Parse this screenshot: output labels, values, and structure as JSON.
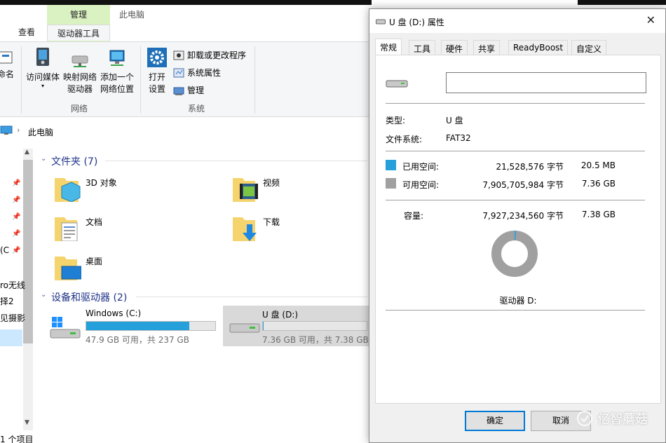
{
  "explorer": {
    "ribbon": {
      "context_group": "管理",
      "window_title": "此电脑",
      "tabs": [
        "查看",
        "驱动器工具"
      ],
      "left_cut_label": "命名",
      "buttons": {
        "media": "访问媒体",
        "map_line1": "映射网络",
        "map_line2": "驱动器",
        "addnet_line1": "添加一个",
        "addnet_line2": "网络位置",
        "open_line1": "打开",
        "open_line2": "设置"
      },
      "small_buttons": [
        "卸载或更改程序",
        "系统属性",
        "管理"
      ],
      "groups": {
        "network": "网络",
        "system": "系统"
      }
    },
    "address": {
      "path": "此电脑"
    },
    "nav": {
      "items": [
        "(C",
        "ro无线",
        "择2",
        "见摄影"
      ]
    },
    "folders_section": {
      "title": "文件夹 (7)",
      "folders": [
        {
          "name": "3D 对象",
          "icon": "3d-objects-folder-icon"
        },
        {
          "name": "视频",
          "icon": "videos-folder-icon"
        },
        {
          "name": "文档",
          "icon": "documents-folder-icon"
        },
        {
          "name": "下载",
          "icon": "downloads-folder-icon"
        },
        {
          "name": "桌面",
          "icon": "desktop-folder-icon"
        }
      ]
    },
    "devices_section": {
      "title": "设备和驱动器 (2)",
      "drives": [
        {
          "name": "Windows (C:)",
          "info": "47.9 GB 可用，共 237 GB",
          "used_fraction": 0.8
        },
        {
          "name": "U 盘 (D:)",
          "info": "7.36 GB 可用，共 7.38 GB",
          "used_fraction": 0.003
        }
      ]
    },
    "status_bar": "1 个项目"
  },
  "dialog": {
    "title": "U 盘 (D:) 属性",
    "close_glyph": "✕",
    "tabs": [
      "常规",
      "工具",
      "硬件",
      "共享",
      "ReadyBoost",
      "自定义"
    ],
    "active_tab": "常规",
    "name_value": "",
    "type_label": "类型:",
    "type_value": "U 盘",
    "fs_label": "文件系统:",
    "fs_value": "FAT32",
    "used": {
      "label": "已用空间:",
      "bytes": "21,528,576 字节",
      "size": "20.5 MB",
      "color": "#26a0da"
    },
    "free": {
      "label": "可用空间:",
      "bytes": "7,905,705,984 字节",
      "size": "7.36 GB",
      "color": "#a0a0a0"
    },
    "capacity": {
      "label": "容量:",
      "bytes": "7,927,234,560 字节",
      "size": "7.38 GB"
    },
    "drive_label": "驱动器 D:",
    "used_fraction": 0.0027,
    "buttons": {
      "ok": "确定",
      "cancel": "取消"
    }
  },
  "watermark": "亿智蘑菇"
}
